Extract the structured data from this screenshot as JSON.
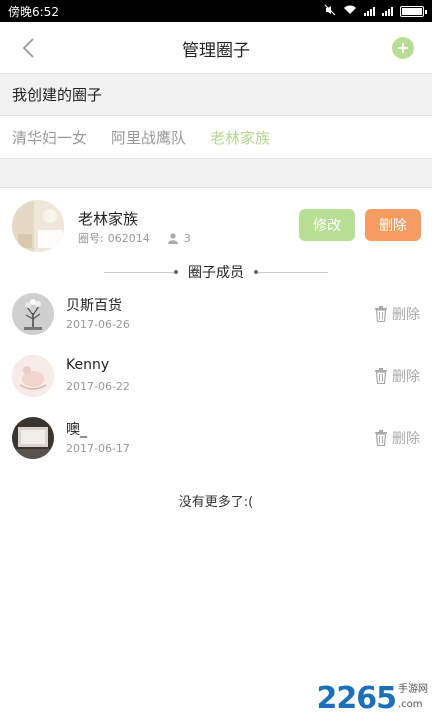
{
  "status_bar": {
    "time": "傍晚6:52"
  },
  "header": {
    "title": "管理圈子"
  },
  "section_title": "我创建的圈子",
  "tabs": [
    {
      "label": "清华妇一女",
      "active": false
    },
    {
      "label": "阿里战鹰队",
      "active": false
    },
    {
      "label": "老林家族",
      "active": true
    }
  ],
  "circle": {
    "name": "老林家族",
    "id_label": "圈号:",
    "id_value": "062014",
    "member_count": "3",
    "edit_label": "修改",
    "delete_label": "删除"
  },
  "members_heading": "圈子成员",
  "members": [
    {
      "name": "贝斯百货",
      "date": "2017-06-26",
      "delete_label": "删除"
    },
    {
      "name": "Kenny",
      "date": "2017-06-22",
      "delete_label": "删除"
    },
    {
      "name": "噢_",
      "date": "2017-06-17",
      "delete_label": "删除"
    }
  ],
  "no_more": "没有更多了:(",
  "watermark": {
    "number": "2265",
    "sub1": "手游网",
    "sub2": ".com"
  },
  "colors": {
    "accent_green": "#b4d88e",
    "delete_orange": "#f59c63",
    "edit_green": "#b9df97"
  }
}
